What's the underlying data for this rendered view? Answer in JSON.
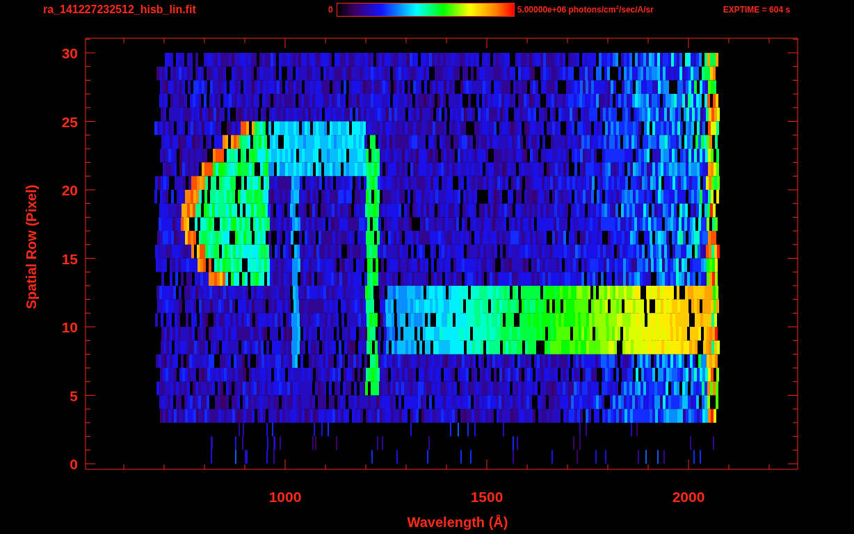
{
  "title": "ra_141227232512_hisb_lin.fit",
  "colorbar": {
    "min_label": "0",
    "max_label": "5.00000e+06 photons/cm$^{2}$/sec/A/sr"
  },
  "exposure": "EXPTIME = 604 s",
  "plot": {
    "xlabel": "Wavelength (Å)",
    "ylabel": "Spatial Row (Pixel)",
    "xticks": [
      "1000",
      "1500",
      "2000"
    ],
    "yticks": [
      "30",
      "25",
      "20",
      "15",
      "10",
      "5",
      "0"
    ]
  }
}
